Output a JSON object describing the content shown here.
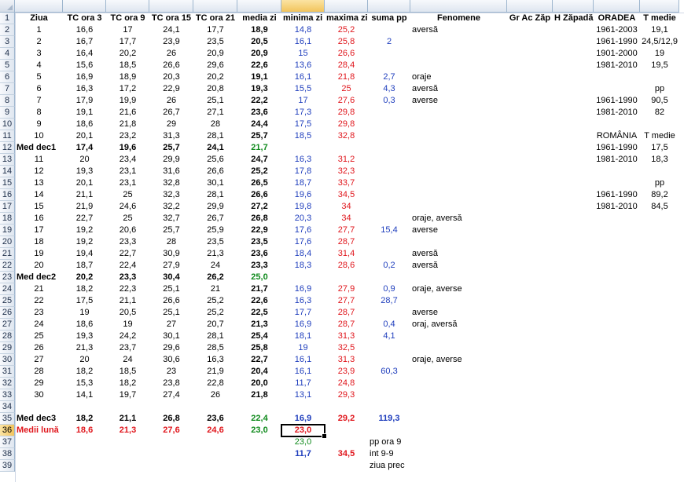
{
  "columns": [
    "A",
    "B",
    "C",
    "D",
    "E",
    "F",
    "G",
    "H",
    "I",
    "J",
    "K",
    "L",
    "M",
    "N"
  ],
  "selected_column": "G",
  "selected_row": 36,
  "row_count": 39,
  "headers": {
    "A": "Ziua",
    "B": "TC ora 3",
    "C": "TC ora 9",
    "D": "TC ora 15",
    "E": "TC ora 21",
    "F": "media zi",
    "G": "minima zi",
    "H": "maxima zi",
    "I": "suma pp",
    "J": "Fenomene",
    "K": "Gr Ac Zăp",
    "L": "H Zăpadă",
    "M": "ORADEA",
    "N": "T medie"
  },
  "colors": {
    "minima": "#1f3ebd",
    "maxima": "#e0161c",
    "media": "#0f8a1c",
    "suma": "#1f3ebd"
  },
  "days": [
    {
      "row": 2,
      "A": "1",
      "B": "16,6",
      "C": "17",
      "D": "24,1",
      "E": "17,7",
      "F": "18,9",
      "G": "14,8",
      "H": "25,2",
      "I": "",
      "J": "aversă"
    },
    {
      "row": 3,
      "A": "2",
      "B": "16,7",
      "C": "17,7",
      "D": "23,9",
      "E": "23,5",
      "F": "20,5",
      "G": "16,1",
      "H": "25,8",
      "I": "2",
      "J": ""
    },
    {
      "row": 4,
      "A": "3",
      "B": "16,4",
      "C": "20,2",
      "D": "26",
      "E": "20,9",
      "F": "20,9",
      "G": "15",
      "H": "26,6",
      "I": "",
      "J": ""
    },
    {
      "row": 5,
      "A": "4",
      "B": "15,6",
      "C": "18,5",
      "D": "26,6",
      "E": "29,6",
      "F": "22,6",
      "G": "13,6",
      "H": "28,4",
      "I": "",
      "J": ""
    },
    {
      "row": 6,
      "A": "5",
      "B": "16,9",
      "C": "18,9",
      "D": "20,3",
      "E": "20,2",
      "F": "19,1",
      "G": "16,1",
      "H": "21,8",
      "I": "2,7",
      "J": "oraje"
    },
    {
      "row": 7,
      "A": "6",
      "B": "16,3",
      "C": "17,2",
      "D": "22,9",
      "E": "20,8",
      "F": "19,3",
      "G": "15,5",
      "H": "25",
      "I": "4,3",
      "J": "aversă"
    },
    {
      "row": 8,
      "A": "7",
      "B": "17,9",
      "C": "19,9",
      "D": "26",
      "E": "25,1",
      "F": "22,2",
      "G": "17",
      "H": "27,6",
      "I": "0,3",
      "J": "averse"
    },
    {
      "row": 9,
      "A": "8",
      "B": "19,1",
      "C": "21,6",
      "D": "26,7",
      "E": "27,1",
      "F": "23,6",
      "G": "17,3",
      "H": "29,8",
      "I": "",
      "J": ""
    },
    {
      "row": 10,
      "A": "9",
      "B": "18,6",
      "C": "21,8",
      "D": "29",
      "E": "28",
      "F": "24,4",
      "G": "17,5",
      "H": "29,8",
      "I": "",
      "J": ""
    },
    {
      "row": 11,
      "A": "10",
      "B": "20,1",
      "C": "23,2",
      "D": "31,3",
      "E": "28,1",
      "F": "25,7",
      "G": "18,5",
      "H": "32,8",
      "I": "",
      "J": ""
    },
    {
      "row": 13,
      "A": "11",
      "B": "20",
      "C": "23,4",
      "D": "29,9",
      "E": "25,6",
      "F": "24,7",
      "G": "16,3",
      "H": "31,2",
      "I": "",
      "J": ""
    },
    {
      "row": 14,
      "A": "12",
      "B": "19,3",
      "C": "23,1",
      "D": "31,6",
      "E": "26,6",
      "F": "25,2",
      "G": "17,8",
      "H": "32,3",
      "I": "",
      "J": ""
    },
    {
      "row": 15,
      "A": "13",
      "B": "20,1",
      "C": "23,1",
      "D": "32,8",
      "E": "30,1",
      "F": "26,5",
      "G": "18,7",
      "H": "33,7",
      "I": "",
      "J": ""
    },
    {
      "row": 16,
      "A": "14",
      "B": "21,1",
      "C": "25",
      "D": "32,3",
      "E": "28,1",
      "F": "26,6",
      "G": "19,6",
      "H": "34,5",
      "I": "",
      "J": ""
    },
    {
      "row": 17,
      "A": "15",
      "B": "21,9",
      "C": "24,6",
      "D": "32,2",
      "E": "29,9",
      "F": "27,2",
      "G": "19,8",
      "H": "34",
      "I": "",
      "J": ""
    },
    {
      "row": 18,
      "A": "16",
      "B": "22,7",
      "C": "25",
      "D": "32,7",
      "E": "26,7",
      "F": "26,8",
      "G": "20,3",
      "H": "34",
      "I": "",
      "J": "oraje, aversă"
    },
    {
      "row": 19,
      "A": "17",
      "B": "19,2",
      "C": "20,6",
      "D": "25,7",
      "E": "25,9",
      "F": "22,9",
      "G": "17,6",
      "H": "27,7",
      "I": "15,4",
      "J": "averse"
    },
    {
      "row": 20,
      "A": "18",
      "B": "19,2",
      "C": "23,3",
      "D": "28",
      "E": "23,5",
      "F": "23,5",
      "G": "17,6",
      "H": "28,7",
      "I": "",
      "J": ""
    },
    {
      "row": 21,
      "A": "19",
      "B": "19,4",
      "C": "22,7",
      "D": "30,9",
      "E": "21,3",
      "F": "23,6",
      "G": "18,4",
      "H": "31,4",
      "I": "",
      "J": "aversă"
    },
    {
      "row": 22,
      "A": "20",
      "B": "18,7",
      "C": "22,4",
      "D": "27,9",
      "E": "24",
      "F": "23,3",
      "G": "18,3",
      "H": "28,6",
      "I": "0,2",
      "J": "aversă"
    },
    {
      "row": 24,
      "A": "21",
      "B": "18,2",
      "C": "22,3",
      "D": "25,1",
      "E": "21",
      "F": "21,7",
      "G": "16,9",
      "H": "27,9",
      "I": "0,9",
      "J": "oraje, averse"
    },
    {
      "row": 25,
      "A": "22",
      "B": "17,5",
      "C": "21,1",
      "D": "26,6",
      "E": "25,2",
      "F": "22,6",
      "G": "16,3",
      "H": "27,7",
      "I": "28,7",
      "J": ""
    },
    {
      "row": 26,
      "A": "23",
      "B": "19",
      "C": "20,5",
      "D": "25,1",
      "E": "25,2",
      "F": "22,5",
      "G": "17,7",
      "H": "28,7",
      "I": "",
      "J": "averse"
    },
    {
      "row": 27,
      "A": "24",
      "B": "18,6",
      "C": "19",
      "D": "27",
      "E": "20,7",
      "F": "21,3",
      "G": "16,9",
      "H": "28,7",
      "I": "0,4",
      "J": "oraj, aversă"
    },
    {
      "row": 28,
      "A": "25",
      "B": "19,3",
      "C": "24,2",
      "D": "30,1",
      "E": "28,1",
      "F": "25,4",
      "G": "18,1",
      "H": "31,3",
      "I": "4,1",
      "J": ""
    },
    {
      "row": 29,
      "A": "26",
      "B": "21,3",
      "C": "23,7",
      "D": "29,6",
      "E": "28,5",
      "F": "25,8",
      "G": "19",
      "H": "32,5",
      "I": "",
      "J": ""
    },
    {
      "row": 30,
      "A": "27",
      "B": "20",
      "C": "24",
      "D": "30,6",
      "E": "16,3",
      "F": "22,7",
      "G": "16,1",
      "H": "31,3",
      "I": "",
      "J": "oraje, averse"
    },
    {
      "row": 31,
      "A": "28",
      "B": "18,2",
      "C": "18,5",
      "D": "23",
      "E": "21,9",
      "F": "20,4",
      "G": "16,1",
      "H": "23,9",
      "I": "60,3",
      "J": ""
    },
    {
      "row": 32,
      "A": "29",
      "B": "15,3",
      "C": "18,2",
      "D": "23,8",
      "E": "22,8",
      "F": "20,0",
      "G": "11,7",
      "H": "24,8",
      "I": "",
      "J": ""
    },
    {
      "row": 33,
      "A": "30",
      "B": "14,1",
      "C": "19,7",
      "D": "27,4",
      "E": "26",
      "F": "21,8",
      "G": "13,1",
      "H": "29,3",
      "I": "",
      "J": ""
    }
  ],
  "decades": [
    {
      "row": 12,
      "A": "Med dec1",
      "B": "17,4",
      "C": "19,6",
      "D": "25,7",
      "E": "24,1",
      "F": "21,7"
    },
    {
      "row": 23,
      "A": "Med dec2",
      "B": "20,2",
      "C": "23,3",
      "D": "30,4",
      "E": "26,2",
      "F": "25,0"
    },
    {
      "row": 35,
      "A": "Med dec3",
      "B": "18,2",
      "C": "21,1",
      "D": "26,8",
      "E": "23,6",
      "F": "22,4",
      "G": "16,9",
      "H": "29,2",
      "I": "119,3"
    }
  ],
  "monthly": {
    "row": 36,
    "A": "Medii lună",
    "B": "18,6",
    "C": "21,3",
    "D": "27,6",
    "E": "24,6",
    "F": "23,0",
    "G": "23,0"
  },
  "extra": [
    {
      "row": 37,
      "G": "23,0",
      "I": "pp ora 9"
    },
    {
      "row": 38,
      "G": "11,7",
      "H": "34,5",
      "I": "int 9-9"
    },
    {
      "row": 39,
      "I": "ziua prec"
    }
  ],
  "side_table": [
    {
      "row": 2,
      "M": "1961-2003",
      "N": "19,1"
    },
    {
      "row": 3,
      "M": "1961-1990",
      "N": "24,5/12,9"
    },
    {
      "row": 4,
      "M": "1901-2000",
      "N": "19"
    },
    {
      "row": 5,
      "M": "1981-2010",
      "N": "19,5"
    },
    {
      "row": 7,
      "M": "",
      "N": "pp"
    },
    {
      "row": 8,
      "M": "1961-1990",
      "N": "90,5"
    },
    {
      "row": 9,
      "M": "1981-2010",
      "N": "82"
    },
    {
      "row": 11,
      "M": "ROMÂNIA",
      "N": "T medie"
    },
    {
      "row": 12,
      "M": "1961-1990",
      "N": "17,5"
    },
    {
      "row": 13,
      "M": "1981-2010",
      "N": "18,3"
    },
    {
      "row": 15,
      "M": "",
      "N": "pp"
    },
    {
      "row": 16,
      "M": "1961-1990",
      "N": "89,2"
    },
    {
      "row": 17,
      "M": "1981-2010",
      "N": "84,5"
    }
  ]
}
